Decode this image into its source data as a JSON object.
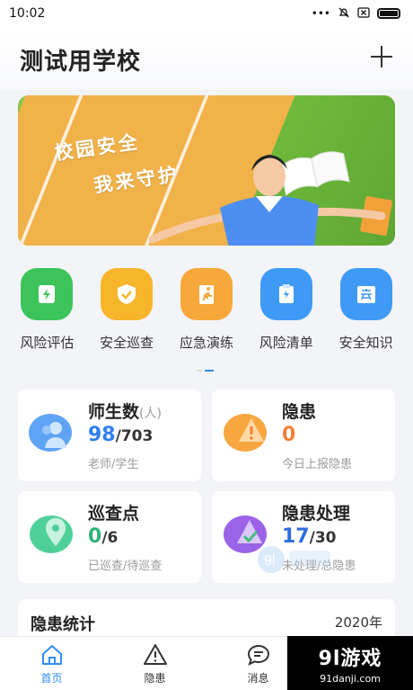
{
  "status_bar": {
    "time": "10:02"
  },
  "header": {
    "title": "测试用学校"
  },
  "banner": {
    "line1": "校园安全",
    "line2": "我来守护"
  },
  "actions": [
    {
      "label": "风险评估",
      "icon": "lightning-icon",
      "color": "#3cc45b"
    },
    {
      "label": "安全巡查",
      "icon": "shield-check-icon",
      "color": "#f7b52b"
    },
    {
      "label": "应急演练",
      "icon": "running-person-icon",
      "color": "#f7a83a"
    },
    {
      "label": "风险清单",
      "icon": "clipboard-icon",
      "color": "#3f9af5"
    },
    {
      "label": "安全知识",
      "icon": "safety-book-icon",
      "color": "#3f9af5"
    }
  ],
  "cards": {
    "staff": {
      "title": "师生数",
      "unit": "(人)",
      "value": "98",
      "total": "/703",
      "sub": "老师/学生"
    },
    "hazard": {
      "title": "隐患",
      "value": "0",
      "sub": "今日上报隐患"
    },
    "patrol": {
      "title": "巡查点",
      "value": "0",
      "total": "/6",
      "sub": "已巡查/待巡查"
    },
    "handling": {
      "title": "隐患处理",
      "value": "17",
      "total": "/30",
      "sub": "未处理/总隐患"
    }
  },
  "stats": {
    "title": "隐患统计",
    "year": "2020年"
  },
  "nav": [
    {
      "label": "首页",
      "active": true
    },
    {
      "label": "隐患",
      "active": false
    },
    {
      "label": "消息",
      "active": false
    }
  ],
  "watermark": {
    "brand": "9l游戏",
    "site": "91danji.com"
  }
}
